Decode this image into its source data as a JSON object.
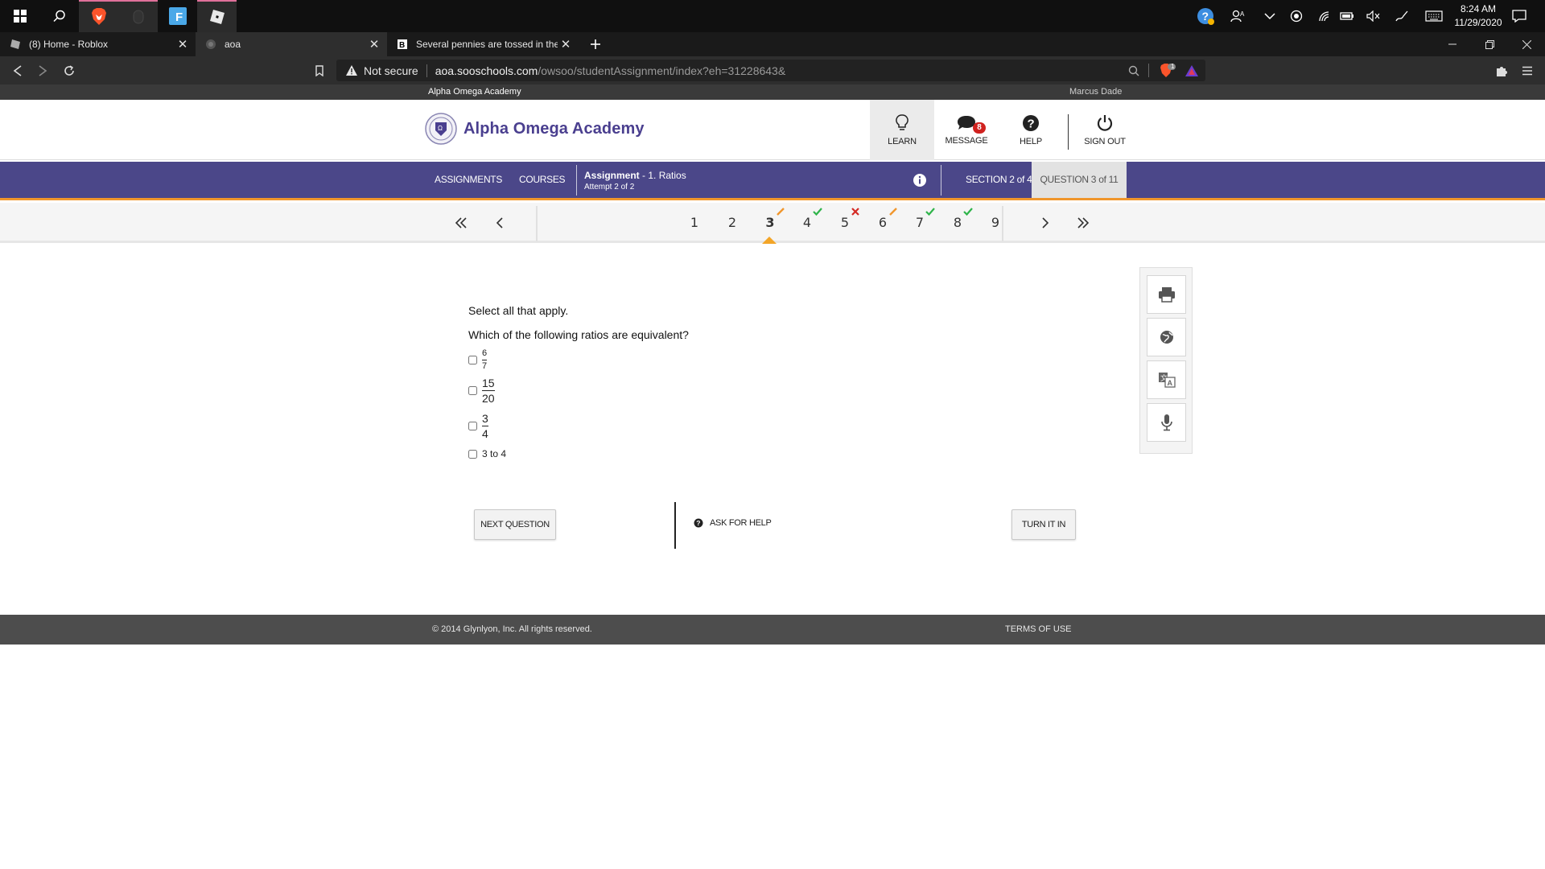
{
  "taskbar": {
    "clock_time": "8:24 AM",
    "clock_date": "11/29/2020"
  },
  "browser": {
    "tabs": [
      {
        "title": "(8) Home - Roblox",
        "active": false
      },
      {
        "title": "aoa",
        "active": true
      },
      {
        "title": "Several pennies are tossed in the air",
        "active": false
      }
    ],
    "security_label": "Not secure",
    "url_host": "aoa.sooschools.com",
    "url_path": "/owsoo/studentAssignment/index?eh=31228643&",
    "shield_count": "1"
  },
  "site": {
    "school_name_small": "Alpha Omega Academy",
    "student_name": "Marcus Dade",
    "logo_text": "Alpha Omega Academy",
    "nav": {
      "learn": "LEARN",
      "message": "MESSAGE",
      "message_badge": "8",
      "help": "HELP",
      "sign_out": "SIGN OUT"
    }
  },
  "assignment_bar": {
    "assignments": "ASSIGNMENTS",
    "courses": "COURSES",
    "assignment_label": "Assignment",
    "assignment_name": " - 1. Ratios",
    "attempt": "Attempt 2 of 2",
    "section": "SECTION 2 of 4",
    "question": "QUESTION 3 of 11"
  },
  "question_nav": {
    "numbers": [
      "1",
      "2",
      "3",
      "4",
      "5",
      "6",
      "7",
      "8",
      "9"
    ],
    "current": "3",
    "marks": {
      "3": "answered",
      "4": "correct",
      "5": "incorrect",
      "6": "answered",
      "7": "correct",
      "8": "correct"
    }
  },
  "question": {
    "instruction": "Select all that apply.",
    "prompt": "Which of the following ratios are equivalent?",
    "options": [
      {
        "numerator": "6",
        "denominator": "7"
      },
      {
        "numerator": "15",
        "denominator": "20"
      },
      {
        "numerator": "3",
        "denominator": "4"
      },
      {
        "text": "3 to 4"
      }
    ]
  },
  "actions": {
    "next": "NEXT QUESTION",
    "ask_help": "ASK FOR HELP",
    "turn_in": "TURN IT IN"
  },
  "footer": {
    "copyright": "© 2014 Glynlyon, Inc. All rights reserved.",
    "terms": "TERMS OF USE"
  },
  "colors": {
    "brand_purple": "#4b4789",
    "accent_orange": "#f0962c",
    "correct_green": "#2fb44a",
    "incorrect_red": "#d42a24"
  }
}
